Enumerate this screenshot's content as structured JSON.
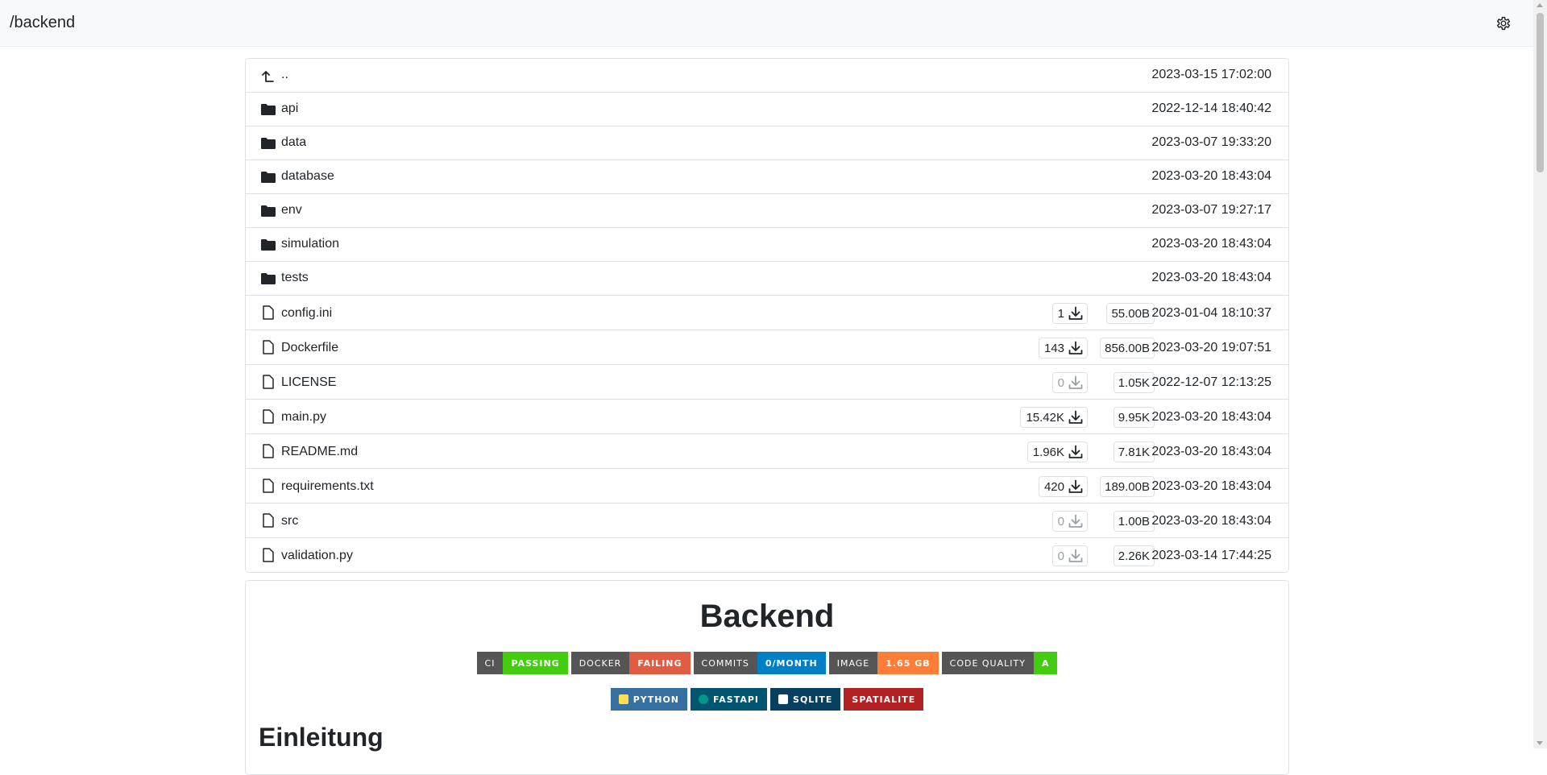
{
  "header": {
    "path": "/backend",
    "settings_icon": "gear-icon"
  },
  "listing": {
    "parent": {
      "name": "..",
      "date": "2023-03-15 17:02:00",
      "icon": "arrow-up-left-icon"
    },
    "folders": [
      {
        "name": "api",
        "date": "2022-12-14 18:40:42"
      },
      {
        "name": "data",
        "date": "2023-03-07 19:33:20"
      },
      {
        "name": "database",
        "date": "2023-03-20 18:43:04"
      },
      {
        "name": "env",
        "date": "2023-03-07 19:27:17"
      },
      {
        "name": "simulation",
        "date": "2023-03-20 18:43:04"
      },
      {
        "name": "tests",
        "date": "2023-03-20 18:43:04"
      }
    ],
    "files": [
      {
        "name": "config.ini",
        "downloads": "1",
        "size": "55.00B",
        "date": "2023-01-04 18:10:37"
      },
      {
        "name": "Dockerfile",
        "downloads": "143",
        "size": "856.00B",
        "date": "2023-03-20 19:07:51"
      },
      {
        "name": "LICENSE",
        "downloads": "0",
        "size": "1.05K",
        "date": "2022-12-07 12:13:25"
      },
      {
        "name": "main.py",
        "downloads": "15.42K",
        "size": "9.95K",
        "date": "2023-03-20 18:43:04"
      },
      {
        "name": "README.md",
        "downloads": "1.96K",
        "size": "7.81K",
        "date": "2023-03-20 18:43:04"
      },
      {
        "name": "requirements.txt",
        "downloads": "420",
        "size": "189.00B",
        "date": "2023-03-20 18:43:04"
      },
      {
        "name": "src",
        "downloads": "0",
        "size": "1.00B",
        "date": "2023-03-20 18:43:04"
      },
      {
        "name": "validation.py",
        "downloads": "0",
        "size": "2.26K",
        "date": "2023-03-14 17:44:25"
      }
    ]
  },
  "readme": {
    "title": "Backend",
    "badges_row1": [
      {
        "label": "CI",
        "value": "PASSING",
        "color": "#4c1"
      },
      {
        "label": "DOCKER",
        "value": "FAILING",
        "color": "#e05d44"
      },
      {
        "label": "COMMITS",
        "value": "0/MONTH",
        "color": "#007ec6"
      },
      {
        "label": "IMAGE",
        "value": "1.65 GB",
        "color": "#fe7d37"
      },
      {
        "label": "CODE QUALITY",
        "value": "A",
        "color": "#4c1"
      }
    ],
    "badges_row2": [
      {
        "label": "PYTHON",
        "color": "#3670a0",
        "logo_color": "#ffdd54"
      },
      {
        "label": "FASTAPI",
        "color": "#005571",
        "logo_color": "#009688"
      },
      {
        "label": "SQLITE",
        "color": "#07405e",
        "logo_color": "#ffffff"
      },
      {
        "label": "SPATIALITE",
        "color": "#b22222",
        "logo_color": ""
      }
    ],
    "heading": "Einleitung"
  }
}
